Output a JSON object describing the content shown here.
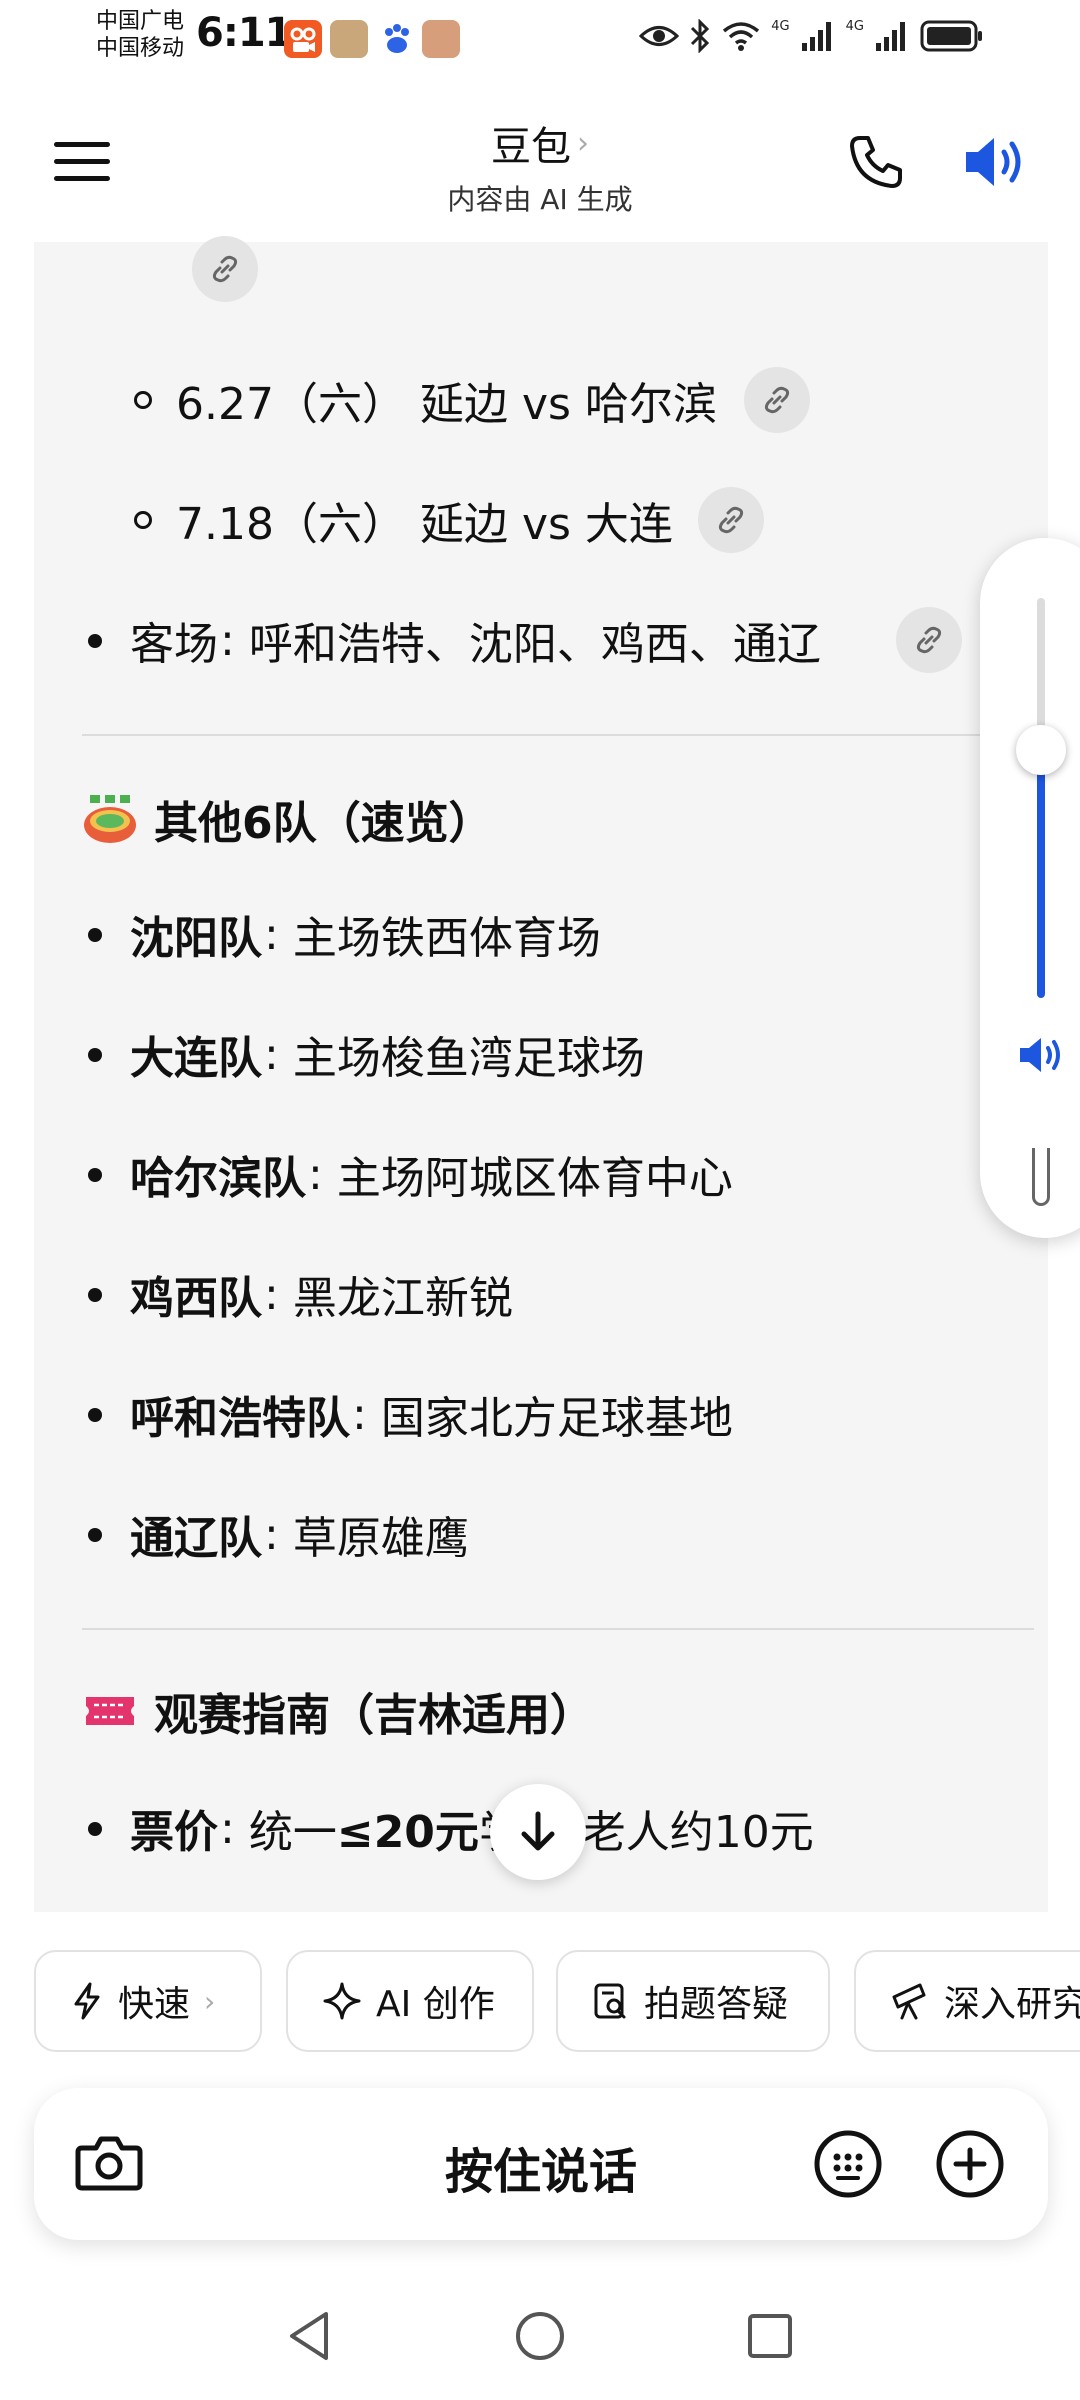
{
  "status_bar": {
    "carrier_1": "中国广电",
    "carrier_2": "中国移动",
    "time": "6:11",
    "net_1": "4G",
    "net_2": "4G"
  },
  "header": {
    "title": "豆包",
    "subtitle": "内容由 AI 生成"
  },
  "content": {
    "match_1": "6.27（六） 延边 vs 哈尔滨",
    "match_2": "7.18（六） 延边 vs 大连",
    "away_label": "客场",
    "away_value": "呼和浩特、沈阳、鸡西、通辽",
    "section_others": "其他6队（速览）",
    "teams": [
      {
        "name": "沈阳队",
        "desc": "主场铁西体育场"
      },
      {
        "name": "大连队",
        "desc": "主场梭鱼湾足球场"
      },
      {
        "name": "哈尔滨队",
        "desc": "主场阿城区体育中心"
      },
      {
        "name": "鸡西队",
        "desc": "黑龙江新锐"
      },
      {
        "name": "呼和浩特队",
        "desc": "国家北方足球基地"
      },
      {
        "name": "通辽队",
        "desc": "草原雄鹰"
      }
    ],
    "section_guide": "观赛指南（吉林适用）",
    "ticket_label": "票价",
    "ticket_prefix": "统一 ",
    "ticket_bold": "≤20元",
    "ticket_suffix": "学生/老人约10元",
    "separator": ":"
  },
  "volume": {
    "level": 0.62
  },
  "chips": {
    "fast": "快速",
    "ai_create": "AI 创作",
    "photo_qa": "拍题答疑",
    "deep_research": "深入研究"
  },
  "input_bar": {
    "hold_to_talk": "按住说话"
  },
  "colors": {
    "accent": "#1d57e0",
    "card_bg": "#f5f5f5"
  }
}
